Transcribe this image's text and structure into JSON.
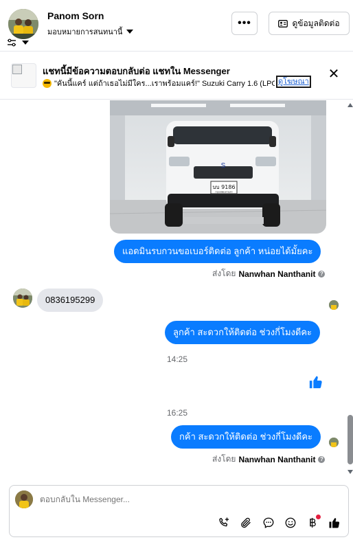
{
  "header": {
    "user_name": "Panom Sorn",
    "assign_label": "มอบหมายการสนทนานี้",
    "more_label": "•••",
    "contact_label": "ดูข้อมูลติดต่อ"
  },
  "banner": {
    "title": "แชทนี้มีข้อความตอบกลับต่อ แชทใน Messenger",
    "subtitle": "\"คันนี้แคร์ แต่ถ้าเธอไม่มีใคร...เราพร้อมแคร์!\" Suzuki Carry 1.6 (LPG) ...",
    "ad_link": "ดูโฆษณา",
    "close_label": "✕"
  },
  "van": {
    "plate_line1": "บบ 9186",
    "plate_line2": "กรุงเทพมหานคร"
  },
  "messages": {
    "out1": "แอดมินรบกวนขอเบอร์ติดต่อ ลูกค้า หน่อยได้มั้ยคะ",
    "sent_by_label": "ส่งโดย",
    "sent_by_name": "Nanwhan Nanthanit",
    "in1": "0836195299",
    "out2": "ลูกค้า  สะดวกให้ติดต่อ ช่วงกี่โมงดีคะ",
    "time1": "14:25",
    "time2": "16:25",
    "out3": "กค้า  สะดวกให้ติดต่อ ช่วงกี่โมงดีคะ",
    "sent_by_label2": "ส่งโดย",
    "sent_by_name2": "Nanwhan Nanthanit"
  },
  "composer": {
    "placeholder": "ตอบกลับใน Messenger..."
  },
  "colors": {
    "messenger_blue": "#0a7cff",
    "bubble_gray": "#e4e6eb",
    "notify_red": "#e41e3f"
  }
}
